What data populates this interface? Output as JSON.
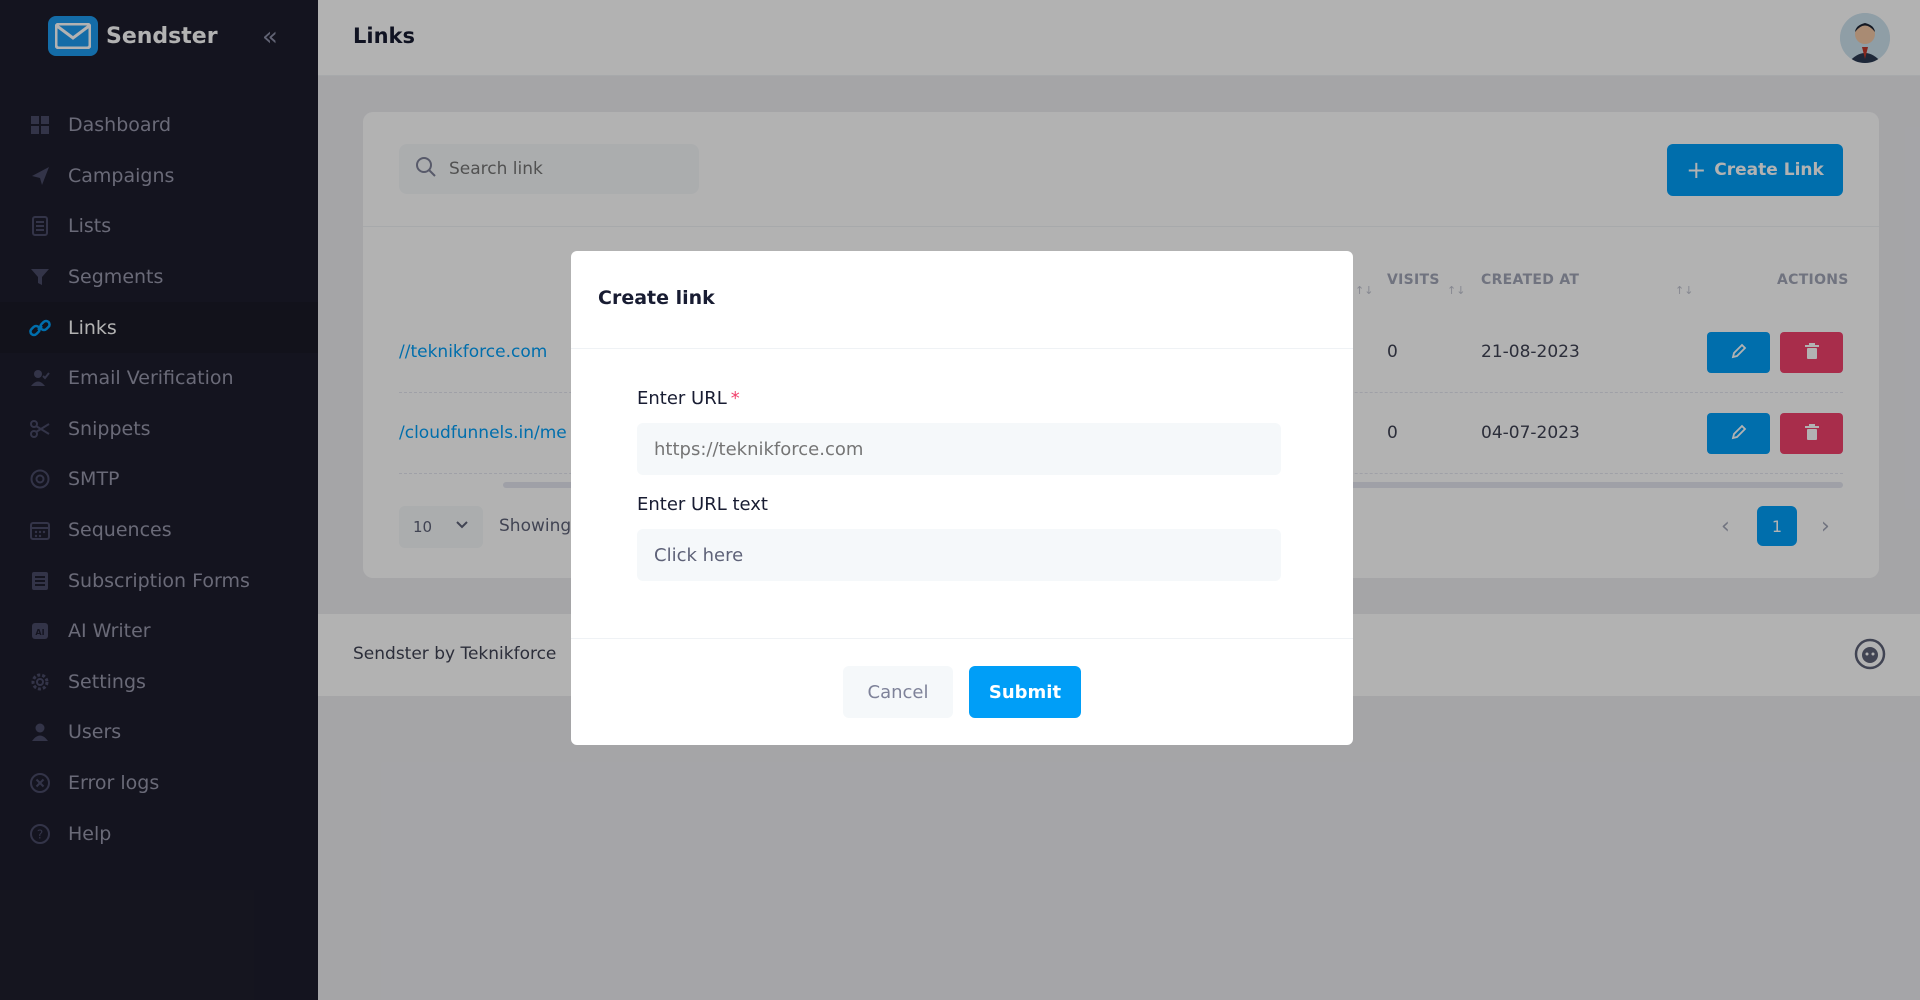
{
  "app": {
    "name": "Sendster"
  },
  "header": {
    "title": "Links"
  },
  "sidebar": {
    "items": [
      {
        "label": "Dashboard",
        "icon": "dashboard-icon"
      },
      {
        "label": "Campaigns",
        "icon": "send-icon"
      },
      {
        "label": "Lists",
        "icon": "list-icon"
      },
      {
        "label": "Segments",
        "icon": "filter-icon"
      },
      {
        "label": "Links",
        "icon": "link-icon",
        "active": true
      },
      {
        "label": "Email Verification",
        "icon": "user-check-icon"
      },
      {
        "label": "Snippets",
        "icon": "scissors-icon"
      },
      {
        "label": "SMTP",
        "icon": "at-sign-icon"
      },
      {
        "label": "Sequences",
        "icon": "calendar-icon"
      },
      {
        "label": "Subscription Forms",
        "icon": "form-icon"
      },
      {
        "label": "AI Writer",
        "icon": "ai-chip-icon"
      },
      {
        "label": "Settings",
        "icon": "gear-icon"
      },
      {
        "label": "Users",
        "icon": "user-icon"
      },
      {
        "label": "Error logs",
        "icon": "x-circle-icon"
      },
      {
        "label": "Help",
        "icon": "help-icon"
      }
    ]
  },
  "toolbar": {
    "search_placeholder": "Search link",
    "create_label": "Create Link"
  },
  "table": {
    "columns": [
      "VISITS",
      "CREATED AT",
      "ACTIONS"
    ],
    "rows": [
      {
        "link": "//teknikforce.com",
        "visits": "0",
        "created_at": "21-08-2023"
      },
      {
        "link": "/cloudfunnels.in/me",
        "visits": "0",
        "created_at": "04-07-2023"
      }
    ]
  },
  "pagination": {
    "page_size": "10",
    "showing_label": "Showing",
    "current_page": "1",
    "prev": "‹",
    "next": "›"
  },
  "footer": {
    "text": "Sendster by Teknikforce"
  },
  "modal": {
    "title": "Create link",
    "url_label": "Enter URL",
    "required_mark": "*",
    "url_placeholder": "https://teknikforce.com",
    "url_value": "",
    "text_label": "Enter URL text",
    "text_value": "Click here",
    "cancel_label": "Cancel",
    "submit_label": "Submit"
  },
  "colors": {
    "primary": "#009ef7",
    "danger": "#f1416c",
    "sidebar_bg": "#1e1e2d"
  }
}
